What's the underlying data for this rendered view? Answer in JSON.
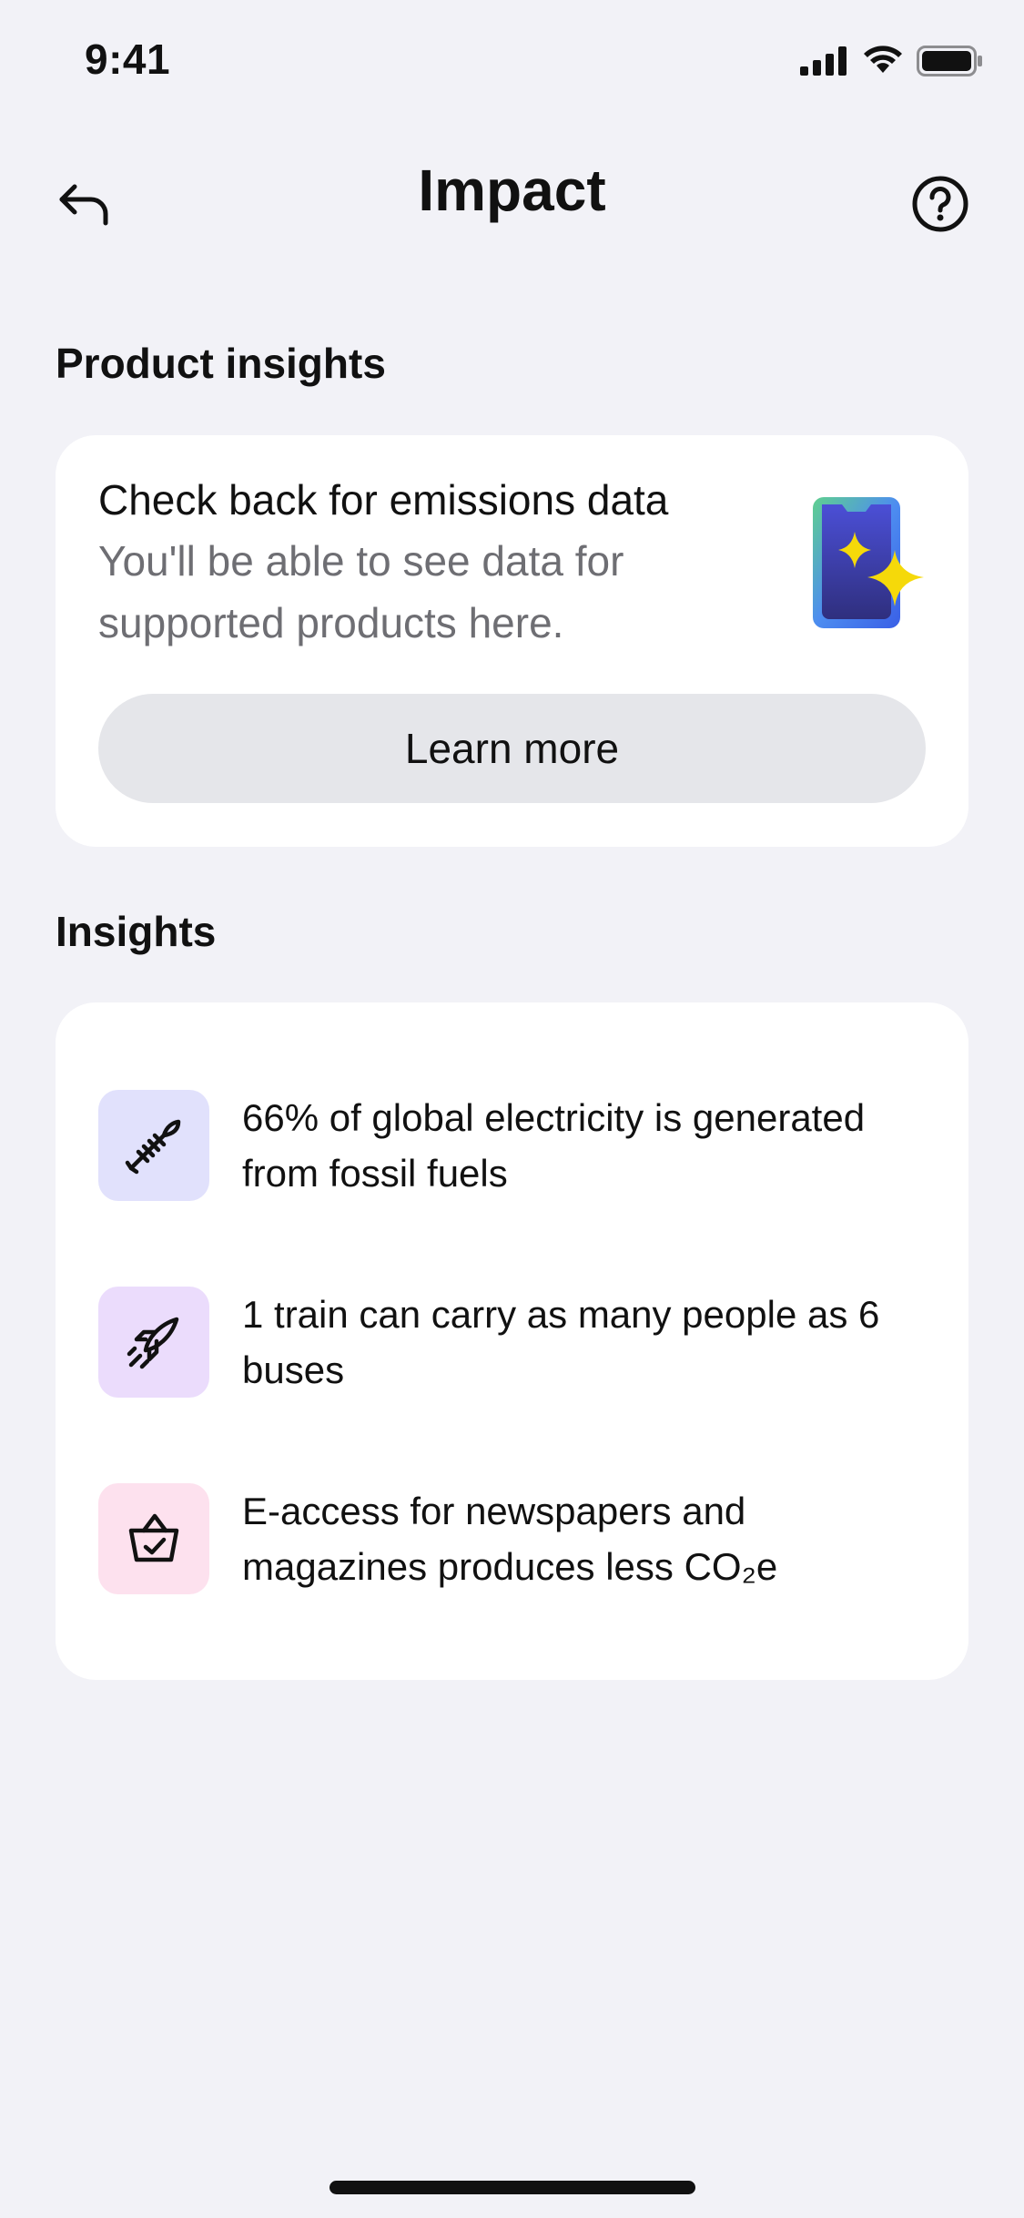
{
  "status_bar": {
    "time": "9:41"
  },
  "header": {
    "title": "Impact"
  },
  "product_insights": {
    "section_title": "Product insights",
    "card_heading": "Check back for emissions data",
    "card_body": "You'll be able to see data for supported products here.",
    "learn_more_label": "Learn more"
  },
  "insights": {
    "section_title": "Insights",
    "items": [
      {
        "text": "66% of global electricity is generated from fossil fuels",
        "icon": "fish-skeleton-icon",
        "icon_bg": "#e1e1fc"
      },
      {
        "text": "1 train can carry as many people as 6 buses",
        "icon": "rocket-icon",
        "icon_bg": "#ebdcfc"
      },
      {
        "text": "E-access for newspapers and magazines produces less CO₂e",
        "icon": "shopping-basket-icon",
        "icon_bg": "#fde1ee"
      }
    ]
  },
  "colors": {
    "background": "#f2f2f7",
    "card": "#ffffff",
    "button_bg": "#e5e6ea",
    "secondary_text": "#6e6e73",
    "sparkle": "#f5d90a",
    "phone_body": "#3b3f9c"
  }
}
